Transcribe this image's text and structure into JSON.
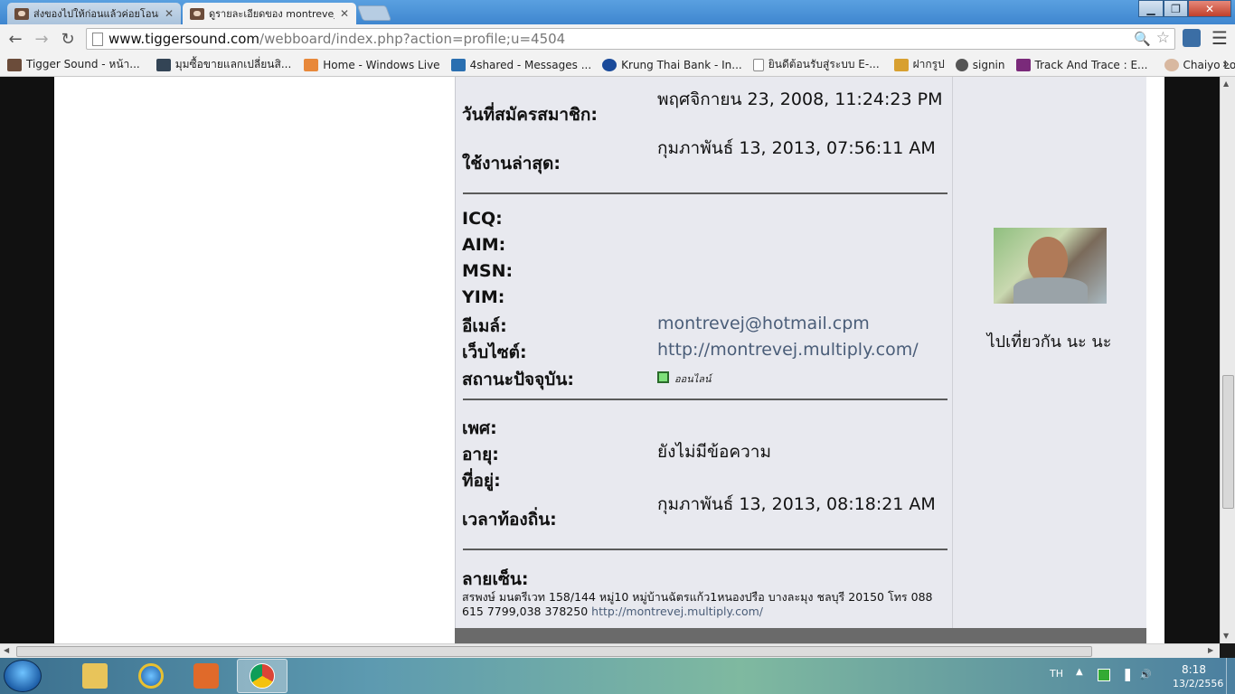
{
  "browser": {
    "tabs": [
      {
        "title": "ส่งของไปให้ก่อนแล้วค่อยโอนเ",
        "active": false
      },
      {
        "title": "ดูรายละเอียดของ montrevej",
        "active": true
      }
    ],
    "url_host": "www.tiggersound.com",
    "url_path": "/webboard/index.php?action=profile;u=4504",
    "bookmarks": [
      {
        "label": "Tigger Sound - หน้า...",
        "color": "#6b4c3a"
      },
      {
        "label": "มุมซื้อขายแลกเปลี่ยนสิ...",
        "color": "#334455"
      },
      {
        "label": "Home - Windows Live",
        "color": "#e8883a"
      },
      {
        "label": "4shared - Messages ...",
        "color": "#2a6fb0"
      },
      {
        "label": "Krung Thai Bank - In...",
        "color": "#1a4a9a"
      },
      {
        "label": "ยินดีต้อนรับสู่ระบบ E-...",
        "color": "#ffffff"
      },
      {
        "label": "ฝากรูป",
        "color": "#d8a030"
      },
      {
        "label": "signin",
        "color": "#555555"
      },
      {
        "label": "Track And Trace : E...",
        "color": "#7a2a7a"
      },
      {
        "label": "Chaiyo Login",
        "color": "#d8b8a0"
      }
    ],
    "bookmarks_more": "»"
  },
  "profile": {
    "rows_top": [
      {
        "label": "วันที่สมัครสมาชิก:",
        "value": "พฤศจิกายน 23, 2008, 11:24:23 PM"
      },
      {
        "label": "ใช้งานล่าสุด:",
        "value": "กุมภาพันธ์ 13, 2013, 07:56:11 AM"
      }
    ],
    "rows_contact": [
      {
        "label": "ICQ:",
        "value": ""
      },
      {
        "label": "AIM:",
        "value": ""
      },
      {
        "label": "MSN:",
        "value": ""
      },
      {
        "label": "YIM:",
        "value": ""
      },
      {
        "label": "อีเมล์:",
        "value": "montrevej@hotmail.cpm"
      },
      {
        "label": "เว็บไซต์:",
        "value": "http://montrevej.multiply.com/"
      },
      {
        "label": "สถานะปัจจุบัน:",
        "value": "ออนไลน์"
      }
    ],
    "rows_personal": [
      {
        "label": "เพศ:",
        "value": ""
      },
      {
        "label": "อายุ:",
        "value": "ยังไม่มีข้อความ"
      },
      {
        "label": "ที่อยู่:",
        "value": ""
      },
      {
        "label": "เวลาท้องถิ่น:",
        "value": "กุมภาพันธ์ 13, 2013, 08:18:21 AM"
      }
    ],
    "signature_label": "ลายเซ็น:",
    "signature_text": "สรพงษ์ มนตรีเวท 158/144 หมู่10 หมู่บ้านฉัตรแก้ว1หนองปรือ บางละมุง ชลบุรี 20150 โทร 088 615 7799,038 378250 ",
    "signature_link": "http://montrevej.multiply.com/",
    "user_text": "ไปเที่ยวกัน นะ นะ"
  },
  "taskbar": {
    "lang": "TH",
    "time": "8:18",
    "date": "13/2/2556"
  }
}
